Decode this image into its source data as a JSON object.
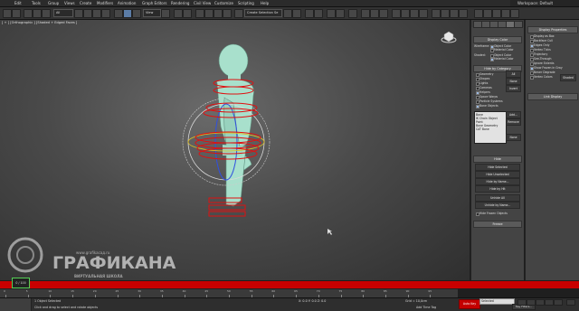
{
  "menubar": {
    "items": [
      "Edit",
      "Tools",
      "Group",
      "Views",
      "Create",
      "Modifiers",
      "Animation",
      "Graph Editors",
      "Rendering",
      "Civil View",
      "Customize",
      "Scripting",
      "Help"
    ],
    "workspace": "Workspace: Default"
  },
  "toolbar": {
    "selection_filter": "All",
    "reference_coord": "View",
    "named_selection": "Create Selection Se"
  },
  "viewport": {
    "label": "[ + ] [Orthographic ] [Shaded + Edged Faces ]",
    "bg_center": "#6a6a6a",
    "bg_edge": "#2f2f2f",
    "model_color": "#a8e0cc",
    "gizmo_color": "#e01010"
  },
  "command_panel": {
    "tabs": [
      "create",
      "modify",
      "hierarchy",
      "motion",
      "display",
      "utilities"
    ],
    "selected_tab": "display",
    "display_color": {
      "title": "Display Color",
      "wireframe_label": "Wireframe:",
      "shaded_label": "Shaded:",
      "object_color": "Object Color",
      "material_color": "Material Color"
    },
    "hide_by_category": {
      "title": "Hide by Category",
      "items": [
        "Geometry",
        "Shapes",
        "Lights",
        "Cameras",
        "Helpers",
        "Space Warps",
        "Particle Systems",
        "Bone Objects"
      ],
      "checked": [
        false,
        false,
        false,
        false,
        true,
        false,
        false,
        true
      ],
      "all_label": "All",
      "none_label": "None",
      "invert_label": "Invert",
      "list": [
        "Bone",
        "IK Chain Object",
        "Point",
        "Bone Geometry",
        "CAT Bone"
      ],
      "add_label": "Add...",
      "remove_label": "Remove",
      "none2_label": "None"
    },
    "hide": {
      "title": "Hide",
      "buttons": [
        "Hide Selected",
        "Hide Unselected",
        "Hide by Name...",
        "Hide by Hit",
        "Unhide All",
        "Unhide by Name..."
      ],
      "hide_frozen": "Hide Frozen Objects"
    },
    "freeze_title": "Freeze"
  },
  "display_panel": {
    "title": "Display Properties",
    "items": [
      "Display as Box",
      "Backface Cull",
      "Edges Only",
      "Vertex Ticks",
      "Trajectory",
      "See-Through",
      "Ignore Extents",
      "Show Frozen in Gray",
      "Never Degrade",
      "Vertex Colors"
    ],
    "checked": [
      false,
      false,
      true,
      false,
      false,
      false,
      false,
      true,
      false,
      false
    ],
    "shaded_btn": "Shaded",
    "link_title": "Link Display"
  },
  "timeline": {
    "frame": "0 / 100",
    "ticks": [
      "0",
      "10",
      "20",
      "30",
      "40",
      "50",
      "60",
      "70",
      "80",
      "90",
      "100"
    ],
    "ticks_visible": [
      "0",
      "5",
      "10",
      "15",
      "20",
      "25",
      "30",
      "35",
      "40",
      "45",
      "50",
      "55",
      "60",
      "65",
      "70",
      "75",
      "80",
      "85",
      "90",
      "95"
    ],
    "redbar_color": "#c80000"
  },
  "status": {
    "line1": "1 Object Selected",
    "line2": "Click and drag to select and rotate objects",
    "coords": "X: 0.0   Y: 0.0   Z: 0.0",
    "grid": "Grid = 10,0cm",
    "add_time_tag": "Add Time Tag",
    "autokey": "Auto Key",
    "setkey": "Set Key",
    "selected": "Selected",
    "key_filters": "Key Filters..."
  },
  "watermark": {
    "site": "www.grafikaсад.ru",
    "brand": "ГРАФИКАНА",
    "tagline": "ВИРТУАЛЬНАЯ ШКОЛА"
  }
}
